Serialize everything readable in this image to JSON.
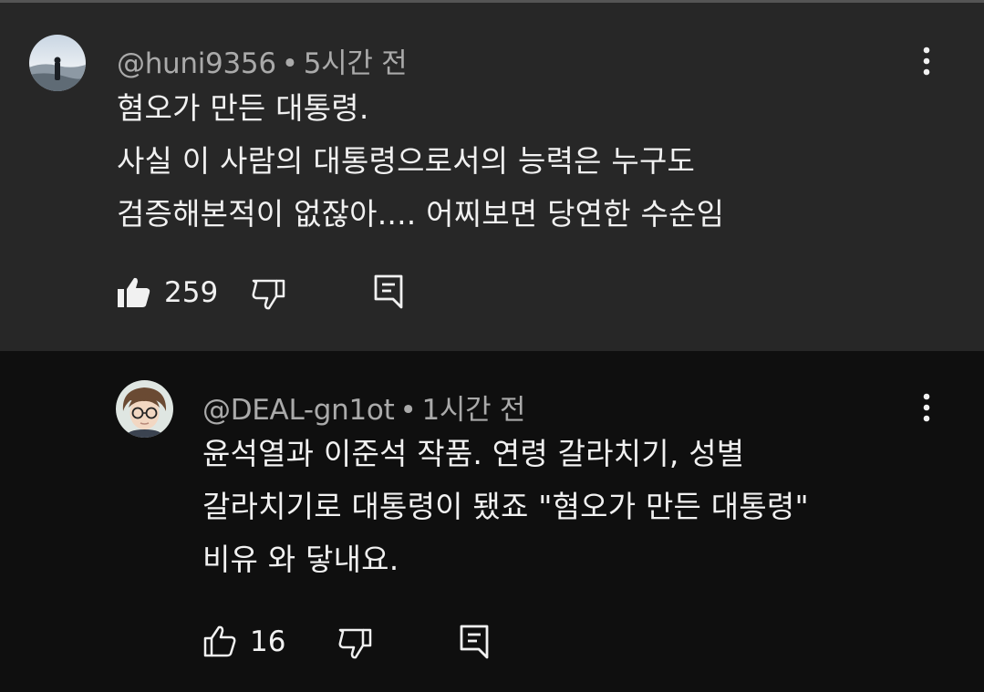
{
  "colors": {
    "background": "#0f0f0f",
    "highlight_background": "#272727",
    "primary_text": "#f1f1f1",
    "secondary_text": "#aaaaaa"
  },
  "comments": [
    {
      "author": "@huni9356",
      "separator": "•",
      "time": "5시간 전",
      "lines": [
        "혐오가 만든 대통령.",
        "사실 이 사람의 대통령으로서의 능력은 누구도",
        "검증해본적이 없잖아.... 어찌보면 당연한 수순임"
      ],
      "likes": "259",
      "icons": {
        "like": "thumbs-up-filled-icon",
        "dislike": "thumbs-down-icon",
        "reply": "reply-icon",
        "more": "more-vert-icon"
      }
    },
    {
      "author": "@DEAL-gn1ot",
      "separator": "•",
      "time": "1시간 전",
      "lines": [
        "윤석열과 이준석 작품. 연령 갈라치기, 성별",
        "갈라치기로 대통령이 됐죠 \"혐오가 만든 대통령\"",
        "비유 와 닿내요."
      ],
      "likes": "16",
      "icons": {
        "like": "thumbs-up-outline-icon",
        "dislike": "thumbs-down-icon",
        "reply": "reply-icon",
        "more": "more-vert-icon"
      }
    }
  ]
}
